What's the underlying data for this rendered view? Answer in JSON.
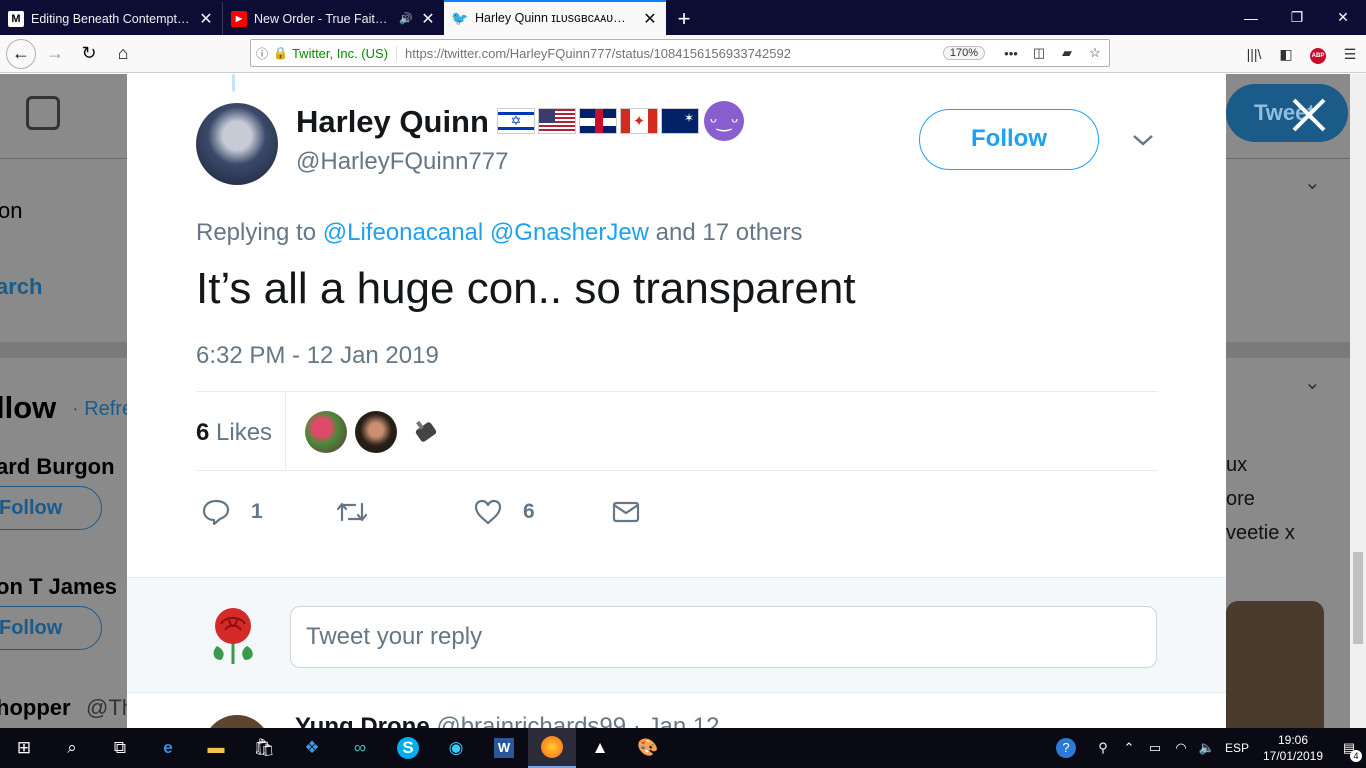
{
  "browser": {
    "tabs": [
      {
        "icon": "M",
        "title": "Editing Beneath Contempt: Ho",
        "active": false
      },
      {
        "icon": "youtube-icon",
        "title": "New Order - True Faith - Yo",
        "active": false,
        "sound": true
      },
      {
        "icon": "twitter-icon",
        "title": "Harley Quinn ɪʟᴜsɢʙᴄᴀᴀᴜ😈 on",
        "active": true
      }
    ],
    "site_identity": "Twitter, Inc. (US)",
    "url": "https://twitter.com/HarleyFQuinn777/status/1084156156933742592",
    "zoom": "170%"
  },
  "background_page": {
    "left_texts": [
      "on",
      "arch",
      "llow",
      "· Refres",
      "ard Burgon",
      "on T James",
      "hopper",
      "@Th"
    ],
    "follow_label": "Follow",
    "tweet_button": "Tweet",
    "right_texts": [
      "ux",
      "ore",
      "veetie x"
    ]
  },
  "tweet": {
    "author_name": "Harley Quinn",
    "author_handle": "@HarleyFQuinn777",
    "follow_label": "Follow",
    "replying_prefix": "Replying to",
    "reply_mentions": [
      "@Lifeonacanal",
      "@GnasherJew"
    ],
    "reply_others": "and 17 others",
    "text": "It’s all a huge con.. so transparent",
    "timestamp": "6:32 PM - 12 Jan 2019",
    "likes_count": "6",
    "likes_label": "Likes",
    "reply_count": "1",
    "like_count_action": "6"
  },
  "reply_box": {
    "placeholder": "Tweet your reply"
  },
  "next_tweet": {
    "name": "Yung Drone",
    "handle": "@brainrichards99",
    "date": "· Jan 12"
  },
  "taskbar": {
    "language": "ESP",
    "time": "19:06",
    "date": "17/01/2019",
    "notifications": "4"
  },
  "colors": {
    "twitter_blue": "#1da1f2",
    "text_dark": "#14171a",
    "text_gray": "#657786",
    "overlay_gray": "#808080"
  }
}
